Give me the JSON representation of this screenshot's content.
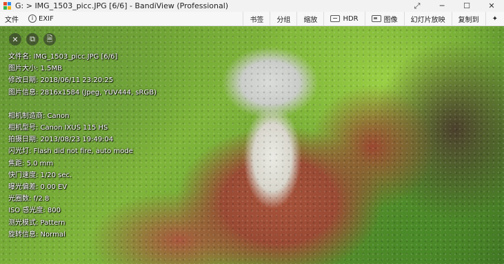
{
  "titlebar": {
    "title": "G: > IMG_1503_picc.JPG [6/6] - BandiView (Professional)",
    "controls": [
      "⤢",
      "─",
      "☐",
      "✕"
    ]
  },
  "menubar": {
    "file_label": "文件",
    "exif_label": "EXIF",
    "toolbar": {
      "bookmark": "书签",
      "split": "分组",
      "zoom": "缩放",
      "hdr": "HDR",
      "image": "图像",
      "slideshow": "幻灯片放映",
      "copy_to": "复制到",
      "pin": "✦"
    }
  },
  "overlay_buttons": [
    "✕",
    "⧉",
    "🗎"
  ],
  "exif": {
    "file_name": "文件名: IMG_1503_picc.JPG [6/6]",
    "file_size": "图片大小: 1.5MB",
    "modified": "修改日期: 2018/06/11 23:20:25",
    "image_info": "图片信息: 2816x1584 (Jpeg, YUV444, sRGB)",
    "camera_make": "相机制造商: Canon",
    "camera_model": "相机型号: Canon IXUS 115 HS",
    "date_taken": "拍摄日期: 2013/08/23 19:49:04",
    "flash": "闪光灯: Flash did not fire, auto mode",
    "focal_length": "焦距: 5.0 mm",
    "shutter": "快门速度: 1/20 sec.",
    "exposure_bias": "曝光偏差: 0.00 EV",
    "aperture": "光圈数: f/2.8",
    "iso": "ISO 感光度: 800",
    "metering": "测光模式: Pattern",
    "orientation": "旋转信息: Normal"
  }
}
